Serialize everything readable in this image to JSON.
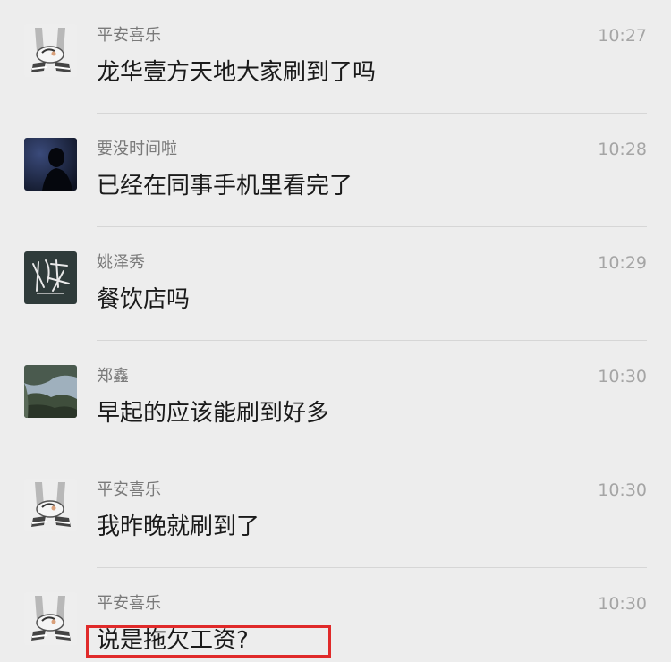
{
  "messages": [
    {
      "name": "平安喜乐",
      "time": "10:27",
      "text": "龙华壹方天地大家刷到了吗",
      "avatar": "cartoon-dog-avatar"
    },
    {
      "name": "要没时间啦",
      "time": "10:28",
      "text": "已经在同事手机里看完了",
      "avatar": "dark-silhouette-avatar"
    },
    {
      "name": "姚泽秀",
      "time": "10:29",
      "text": "餐饮店吗",
      "avatar": "calligraphy-avatar"
    },
    {
      "name": "郑鑫",
      "time": "10:30",
      "text": "早起的应该能刷到好多",
      "avatar": "landscape-avatar"
    },
    {
      "name": "平安喜乐",
      "time": "10:30",
      "text": "我昨晚就刷到了",
      "avatar": "cartoon-dog-avatar"
    },
    {
      "name": "平安喜乐",
      "time": "10:30",
      "text": "说是拖欠工资?",
      "avatar": "cartoon-dog-avatar"
    }
  ],
  "colors": {
    "background": "#ededed",
    "highlight_border": "#e02a2a"
  }
}
